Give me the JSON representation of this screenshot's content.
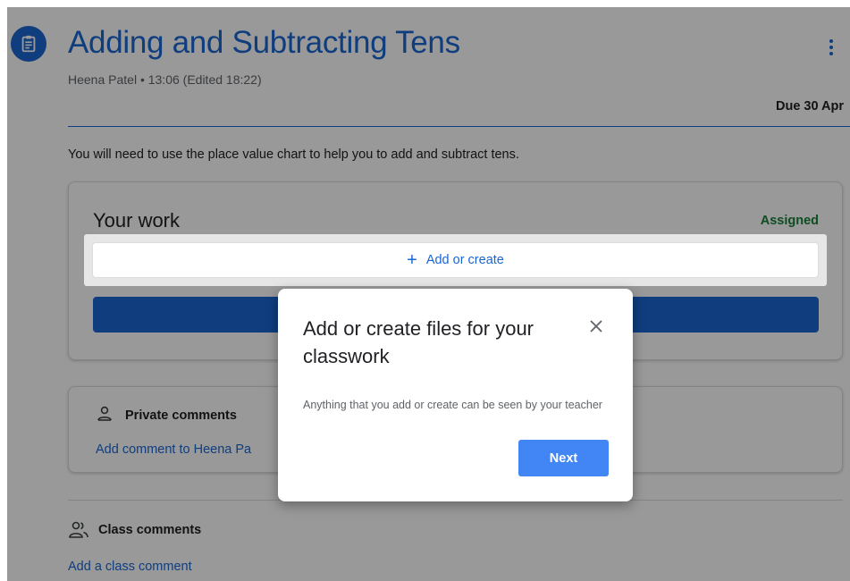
{
  "assignment": {
    "icon": "assignment-icon",
    "title": "Adding and Subtracting Tens",
    "meta": "Heena Patel • 13:06 (Edited 18:22)",
    "due": "Due 30 Apr",
    "instructions": "You will need to use the place value chart to help you to add and subtract tens."
  },
  "your_work": {
    "title": "Your work",
    "status": "Assigned",
    "add_button": {
      "icon": "plus-icon",
      "label": "Add or create"
    }
  },
  "private_comments": {
    "icon": "person-icon",
    "label": "Private comments",
    "link": "Add comment to Heena Pa"
  },
  "class_comments": {
    "icon": "people-icon",
    "label": "Class comments",
    "link": "Add a class comment"
  },
  "dialog": {
    "title": "Add or create files for your classwork",
    "body": "Anything that you add or create can be seen by your teacher",
    "next_label": "Next",
    "close_icon": "close-icon"
  },
  "colors": {
    "accent": "#1967d2",
    "assigned": "#188038",
    "next_button": "#4285f4",
    "scrim": "rgba(0,0,0,0.40)"
  }
}
